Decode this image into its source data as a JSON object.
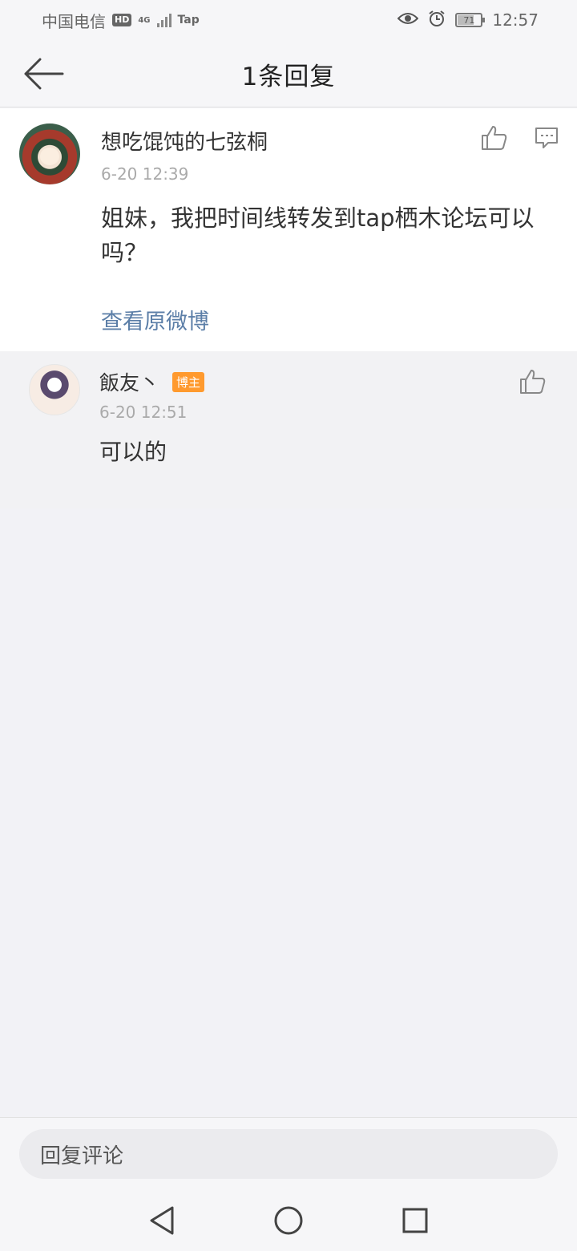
{
  "status_bar": {
    "carrier": "中国电信",
    "hd": "HD",
    "network": "4G",
    "app_tag": "Tap",
    "battery": "71",
    "time": "12:57"
  },
  "header": {
    "title": "1条回复"
  },
  "main_comment": {
    "username": "想吃馄饨的七弦桐",
    "timestamp": "6-20  12:39",
    "text": "姐妹，我把时间线转发到tap栖木论坛可以吗？",
    "view_original": "查看原微博"
  },
  "reply": {
    "username": "飯友丶",
    "badge": "博主",
    "timestamp": "6-20  12:51",
    "text": "可以的"
  },
  "input": {
    "placeholder": "回复评论"
  },
  "colors": {
    "link": "#5b7ea7",
    "badge": "#ff9a2e",
    "background": "#f2f2f6"
  }
}
